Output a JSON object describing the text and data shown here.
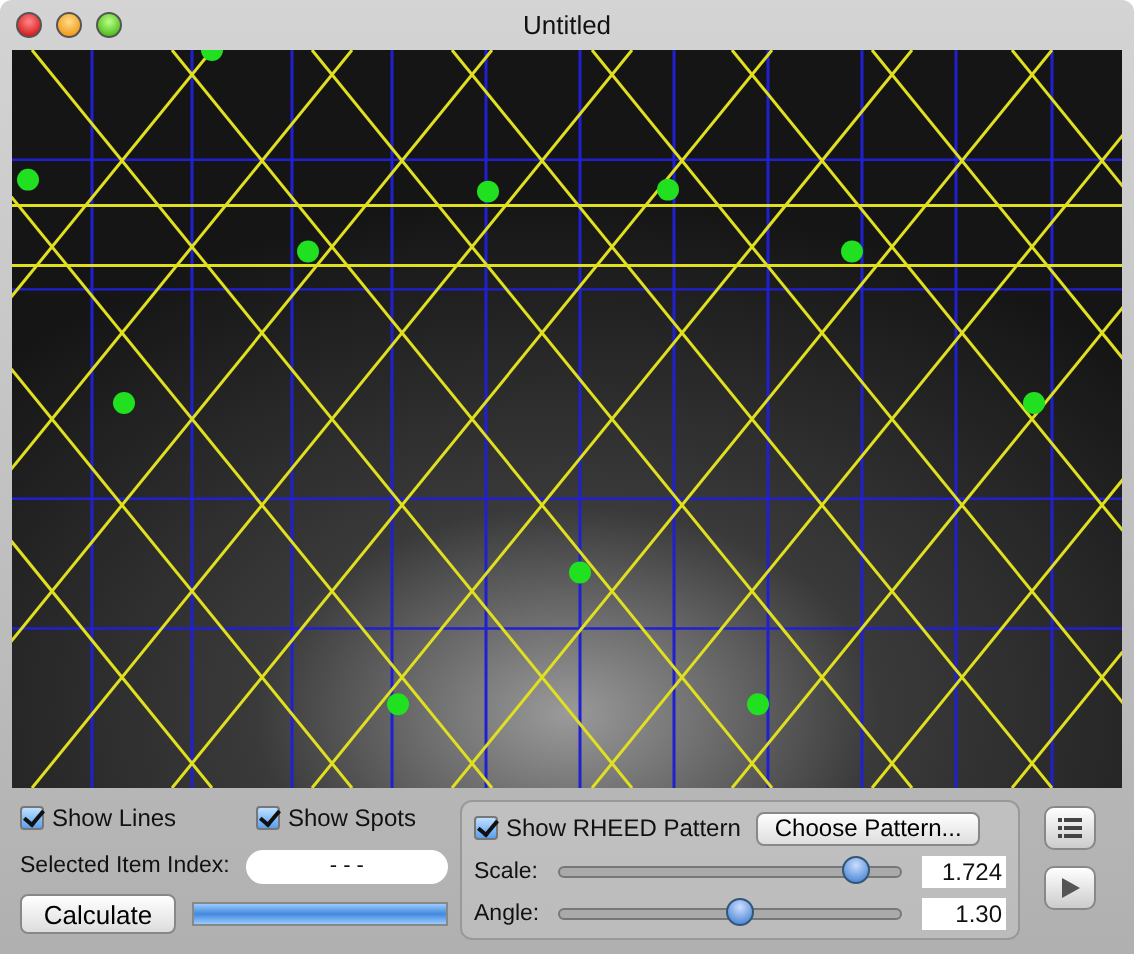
{
  "window": {
    "title": "Untitled"
  },
  "overlay": {
    "show_lines": {
      "label": "Show Lines",
      "checked": true
    },
    "show_spots": {
      "label": "Show Spots",
      "checked": true
    }
  },
  "selected_index": {
    "label": "Selected Item Index:",
    "value": "- - -"
  },
  "calculate": {
    "label": "Calculate"
  },
  "progress": {
    "level": 1
  },
  "rheed": {
    "label": "Show RHEED Pattern",
    "checked": true,
    "choose_button": "Choose Pattern...",
    "sliders": [
      {
        "label": "Scale:",
        "level": 0.87,
        "value": "1.724"
      },
      {
        "label": "Angle:",
        "level": 0.53,
        "value": "1.30"
      }
    ]
  }
}
